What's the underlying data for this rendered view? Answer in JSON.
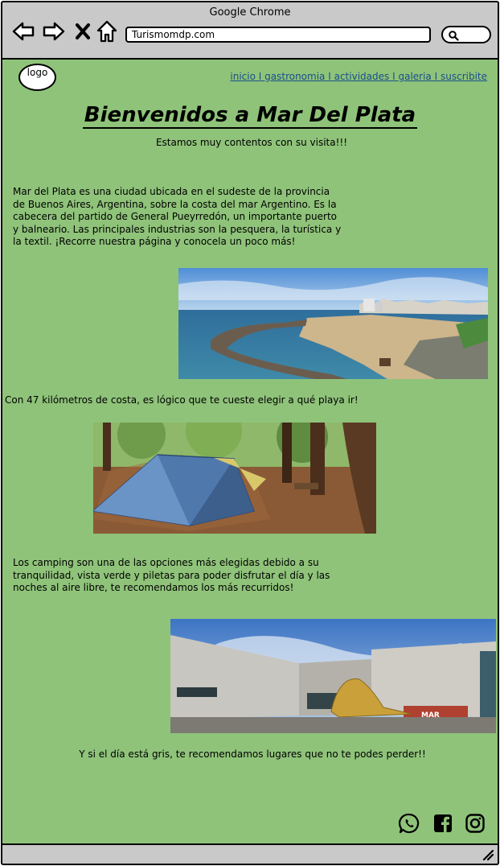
{
  "browser": {
    "window_title": "Google Chrome",
    "url": "Turismomdp.com"
  },
  "header": {
    "logo_text": "logo",
    "nav": [
      {
        "label": "inicio"
      },
      {
        "label": "gastronomia"
      },
      {
        "label": "actividades"
      },
      {
        "label": "galeria"
      },
      {
        "label": "suscribite"
      }
    ],
    "separator": "I"
  },
  "main": {
    "title": "Bienvenidos a Mar Del Plata",
    "subtitle": "Estamos muy contentos con su visita!!!",
    "intro": "Mar del Plata es una ciudad ubicada en el sudeste de la provincia de Buenos Aires, Argentina, sobre la costa del mar Argentino. Es la cabecera del partido de General Pueyrredón, un importante puerto y balneario. Las principales industrias son la pesquera, la turística y la textil. ¡Recorre nuestra página y conocela un poco más!",
    "beach_caption": "Con 47 kilómetros de costa, es lógico que te cueste elegir a qué playa ir!",
    "camping_text": "Los camping son una de las opciones más elegidas debido a su tranquilidad, vista verde y piletas para poder disfrutar el día y las noches al aire libre, te recomendamos los más recurridos!",
    "museum_caption": "Y si el día está gris, te recomendamos lugares que no te podes perder!!",
    "museum_sign": "MAR"
  },
  "footer": {
    "social": [
      "whatsapp-icon",
      "facebook-icon",
      "instagram-icon"
    ]
  },
  "colors": {
    "page_bg": "#8fc37a",
    "chrome_gray": "#c9c9c9",
    "link": "#1a4f8a"
  }
}
